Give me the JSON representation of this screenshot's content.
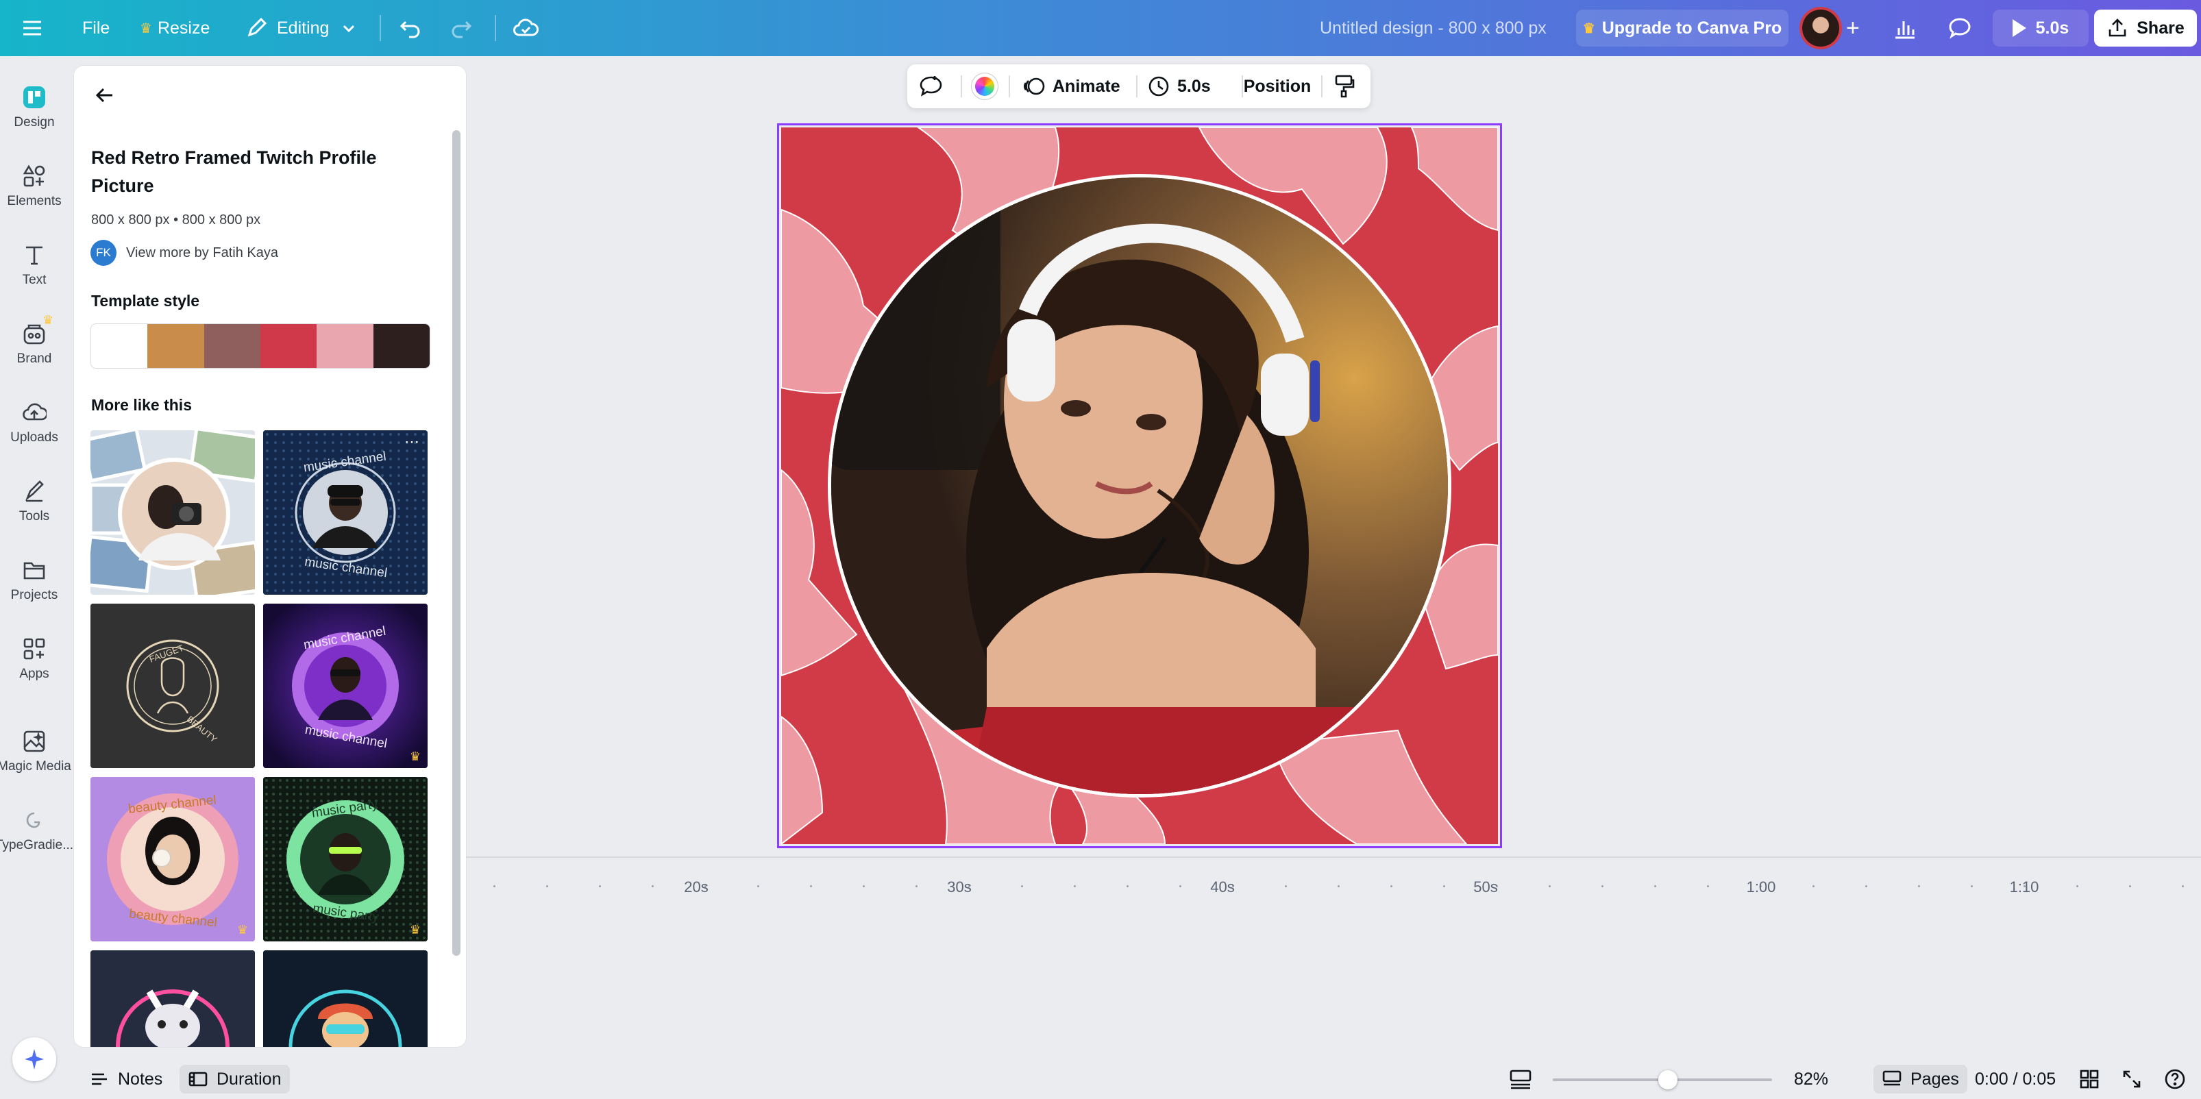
{
  "topbar": {
    "file": "File",
    "resize": "Resize",
    "editing": "Editing",
    "doc_title": "Untitled design - 800 x 800 px",
    "upgrade": "Upgrade to Canva Pro",
    "play_duration": "5.0s",
    "share": "Share"
  },
  "rail": {
    "design": "Design",
    "elements": "Elements",
    "text": "Text",
    "brand": "Brand",
    "uploads": "Uploads",
    "tools": "Tools",
    "projects": "Projects",
    "apps": "Apps",
    "magic_media": "Magic Media",
    "typegradient": "TypeGradie..."
  },
  "panel": {
    "title_line1": "Red Retro Framed Twitch Profile",
    "title_line2": "Picture",
    "dimensions": "800 x 800 px • 800 x 800 px",
    "author_initials": "FK",
    "author_link": "View more by Fatih Kaya",
    "template_style_heading": "Template style",
    "swatches": [
      "#ffffff",
      "#c98c4b",
      "#8e5f5c",
      "#d0394a",
      "#eaa6ae",
      "#2c1f1d"
    ],
    "more_like_this": "More like this",
    "thumbs": {
      "t2_top": "music channel",
      "t2_bottom": "music channel",
      "t3_top": "FAUGET",
      "t3_bottom": "BEAUTY",
      "t4_top": "music channel",
      "t4_bottom": "music channel",
      "t5_top": "beauty channel",
      "t5_bottom": "beauty channel",
      "t6_top": "music party",
      "t6_bottom": "music party"
    }
  },
  "float_toolbar": {
    "animate": "Animate",
    "duration": "5.0s",
    "position": "Position"
  },
  "timeline": {
    "ticks": [
      "20s",
      "30s",
      "40s",
      "50s",
      "1:00",
      "1:10"
    ]
  },
  "bottombar": {
    "notes": "Notes",
    "duration": "Duration",
    "zoom": "82%",
    "pages": "Pages",
    "time": "0:00 / 0:05"
  },
  "colors": {
    "frame_red": "#d13b48",
    "frame_pink": "#ee9aa3",
    "selection": "#8b3dff"
  }
}
